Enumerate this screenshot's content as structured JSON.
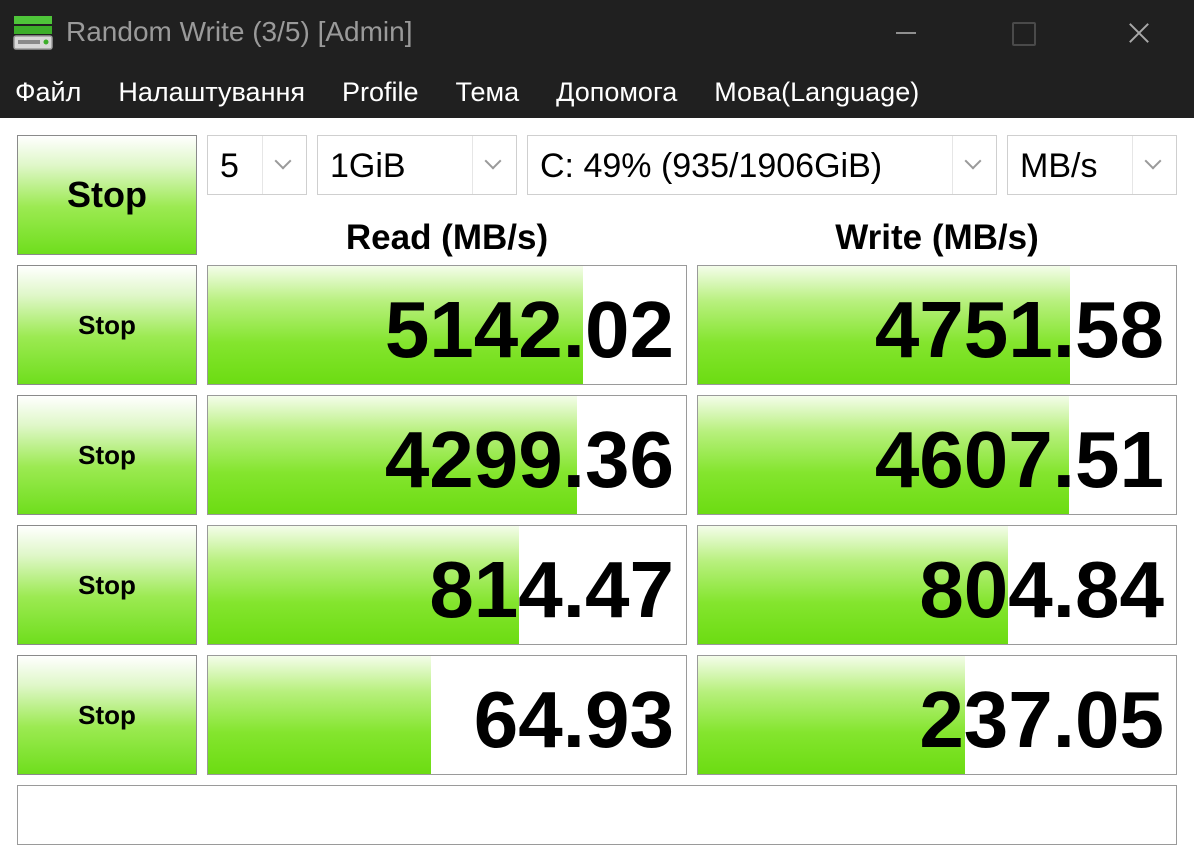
{
  "window": {
    "title": "Random Write (3/5) [Admin]",
    "icon": "disk-benchmark-icon"
  },
  "menu": {
    "items": [
      "Файл",
      "Налаштування",
      "Profile",
      "Тема",
      "Допомога",
      "Мова(Language)"
    ]
  },
  "controls": {
    "main_button": "Stop",
    "count": "5",
    "size": "1GiB",
    "drive": "C: 49% (935/1906GiB)",
    "unit": "MB/s"
  },
  "headers": {
    "read": "Read (MB/s)",
    "write": "Write (MB/s)"
  },
  "rows": [
    {
      "button": "Stop",
      "read": "5142.02",
      "write": "4751.58",
      "read_fill": 0.784,
      "write_fill": 0.778
    },
    {
      "button": "Stop",
      "read": "4299.36",
      "write": "4607.51",
      "read_fill": 0.772,
      "write_fill": 0.776
    },
    {
      "button": "Stop",
      "read": "814.47",
      "write": "804.84",
      "read_fill": 0.651,
      "write_fill": 0.649
    },
    {
      "button": "Stop",
      "read": "64.93",
      "write": "237.05",
      "read_fill": 0.466,
      "write_fill": 0.558
    }
  ],
  "comment": "",
  "colors": {
    "accent_green": "#6cdc12",
    "titlebar_bg": "#202020"
  }
}
